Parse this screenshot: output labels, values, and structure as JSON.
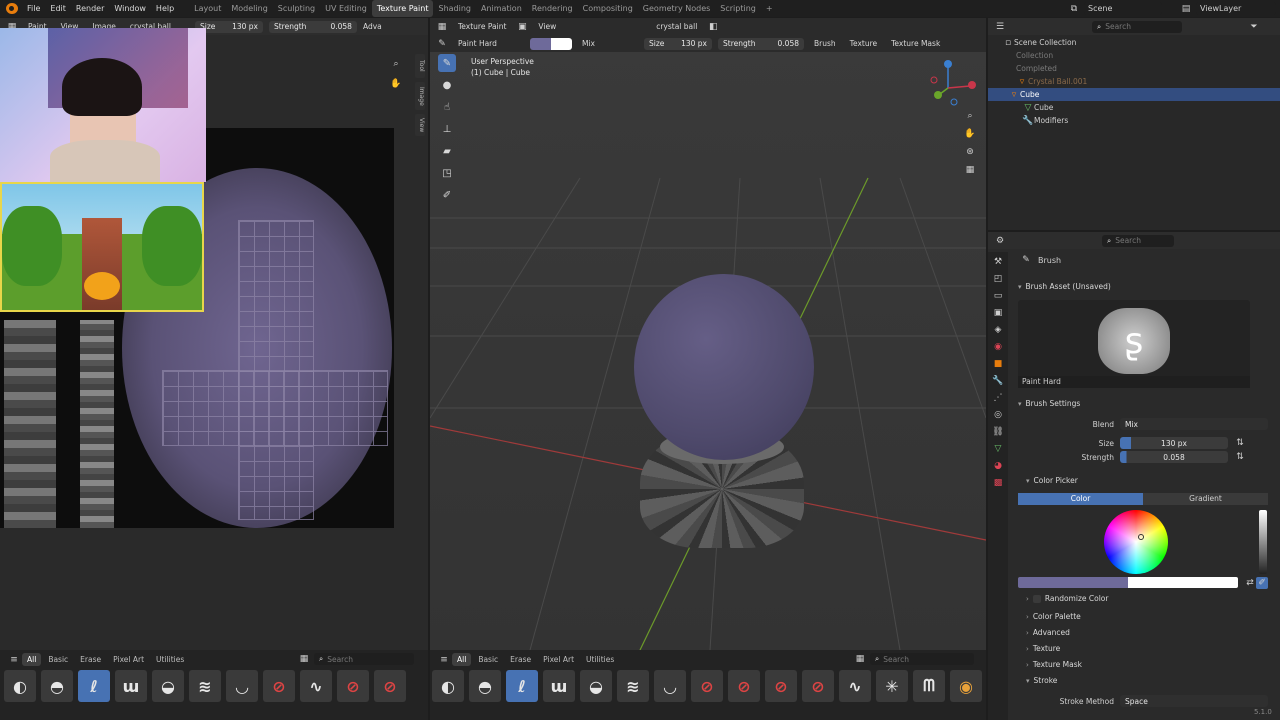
{
  "topbar": {
    "menus": [
      "File",
      "Edit",
      "Render",
      "Window",
      "Help"
    ],
    "workspaces": [
      "Layout",
      "Modeling",
      "Sculpting",
      "UV Editing",
      "Texture Paint",
      "Shading",
      "Animation",
      "Rendering",
      "Compositing",
      "Geometry Nodes",
      "Scripting"
    ],
    "active_workspace": "Texture Paint",
    "add": "+",
    "scene": "Scene",
    "view_layer": "ViewLayer"
  },
  "image_editor": {
    "mode": "Paint",
    "view": "View",
    "image": "Image",
    "image_name": "crystal ball",
    "size_label": "Size",
    "size_value": "130 px",
    "strength_label": "Strength",
    "strength_value": "0.058",
    "overflow": "Adva",
    "side_tabs": [
      "Tool",
      "Image",
      "View"
    ]
  },
  "viewport": {
    "editor": "Texture Paint",
    "view": "View",
    "object": "crystal ball",
    "brush_name": "Paint Hard",
    "blend": "Mix",
    "size_label": "Size",
    "size_value": "130 px",
    "strength_label": "Strength",
    "strength_value": "0.058",
    "menus": [
      "Brush",
      "Texture",
      "Texture Mask"
    ],
    "overlay_title": "User Perspective",
    "overlay_sub": "(1) Cube | Cube"
  },
  "asset_shelf": {
    "tabs": [
      "All",
      "Basic",
      "Erase",
      "Pixel Art",
      "Utilities"
    ],
    "search_placeholder": "Search"
  },
  "outliner": {
    "search_placeholder": "Search",
    "rows": [
      {
        "label": "Scene Collection"
      },
      {
        "label": "Collection"
      },
      {
        "label": "Completed"
      },
      {
        "label": "Crystal Ball.001"
      },
      {
        "label": "Cube"
      },
      {
        "label": "Cube"
      },
      {
        "label": "Modifiers"
      }
    ]
  },
  "properties": {
    "search_placeholder": "Search",
    "header": "Brush",
    "asset_section": "Brush Asset (Unsaved)",
    "brush_asset_name": "Paint Hard",
    "settings_section": "Brush Settings",
    "blend_label": "Blend",
    "blend_value": "Mix",
    "size_label": "Size",
    "size_value": "130 px",
    "strength_label": "Strength",
    "strength_value": "0.058",
    "color_picker": "Color Picker",
    "color_tab": "Color",
    "gradient_tab": "Gradient",
    "randomize": "Randomize Color",
    "collapsed": [
      "Color Palette",
      "Advanced",
      "Texture",
      "Texture Mask",
      "Stroke"
    ],
    "stroke_method_label": "Stroke Method",
    "stroke_method_value": "Space"
  },
  "version": "5.1.0",
  "colors": {
    "accent": "#4772b3",
    "paint_color": "#6e6a9a",
    "orange": "#e87d0d"
  }
}
